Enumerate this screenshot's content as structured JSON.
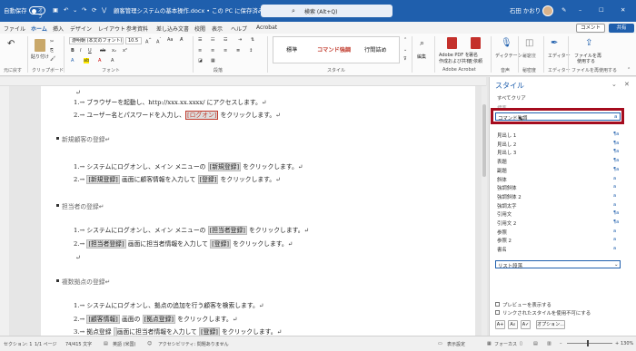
{
  "titlebar": {
    "autosave_label": "自動保存",
    "autosave_state": "オフ",
    "doc_title": "顧客管理システムの基本操作.docx • この PC に保存済み ⌄",
    "search_placeholder": "検索 (Alt+Q)",
    "user_name": "石田 かおり",
    "comment_label": "コメント",
    "share_label": "共有"
  },
  "tabs": [
    "ファイル",
    "ホーム",
    "挿入",
    "デザイン",
    "レイアウト",
    "参考資料",
    "差し込み文書",
    "校閲",
    "表示",
    "ヘルプ",
    "Acrobat"
  ],
  "ribbon": {
    "groups": {
      "undo": "元に戻す",
      "clipboard": "クリップボード",
      "font": "フォント",
      "paragraph": "段落",
      "styles": "スタイル",
      "acrobat": "Adobe Acrobat",
      "voice": "音声",
      "sensitivity": "秘密度",
      "editor": "エディター",
      "share": "ファイルを再使用する"
    },
    "paste": "貼り付け",
    "font_name": "游明朝 (本文のフォント)",
    "font_size": "10.5",
    "style_gallery": [
      "標準",
      "コマンド強調",
      "行間詰め"
    ],
    "editing": "編集",
    "pdf_line1": "Adobe PDF を",
    "pdf_line2": "作成および共有",
    "sign_line1": "署名",
    "sign_line2": "を依頼",
    "dictate": "ディクテーション",
    "sensitivity": "秘密度",
    "editor": "エディター",
    "share_file": "ファイルを再",
    "share_file_line2": "使用する"
  },
  "doc": {
    "para_mark": "↵",
    "s1": {
      "items": {
        "0": "1.→ ブラウザーを起動し、http://xxx.xx.xxxx/ にアクセスします。↵",
        "1a": "2.→ ユーザー名とパスワードを入力し、",
        "1b": "[ログオン]",
        "1c": " をクリックします。↵"
      }
    },
    "s2": {
      "heading": "新規顧客の登録↵",
      "items": {
        "0a": "1.→ システムにログオンし、メイン メニューの ",
        "0b": "[新規登録]",
        "0c": " をクリックします。↵",
        "1a": "2.→ ",
        "1b": "[新規登録]",
        "1c": " 画面に顧客情報を入力して ",
        "1d": "[登録]",
        "1e": " をクリックします。↵"
      }
    },
    "s3": {
      "heading": "担当者の登録↵",
      "items": {
        "0a": "1.→ システムにログオンし、メイン メニューの ",
        "0b": "[担当者登録]",
        "0c": " をクリックします。↵",
        "1a": "2.→ ",
        "1b": "[担当者登録]",
        "1c": " 画面に担当者情報を入力して ",
        "1d": "[登録]",
        "1e": " をクリックします。↵"
      }
    },
    "s4": {
      "heading": "複数拠点の登録↵",
      "items": {
        "0": "1.→ システムにログオンし、拠点の追加を行う顧客を検索します。↵",
        "1a": "2.→ ",
        "1b": "[顧客情報]",
        "1c": " 画面の ",
        "1d": "[拠点登録]",
        "1e": " をクリックします。↵",
        "2a": "3.→ 拠点登録 ",
        "2b": "",
        "2c": "画面に担当者情報を入力して ",
        "2d": "[登録]",
        "2e": " をクリックします。↵"
      }
    }
  },
  "pane": {
    "title": "スタイル",
    "clear_all": "すべてクリア",
    "partial": "標準",
    "selected": "コマンド強調",
    "items": [
      {
        "label": "見出し 1",
        "sym": "¶a"
      },
      {
        "label": "見出し 2",
        "sym": "¶a"
      },
      {
        "label": "見出し 3",
        "sym": "¶a"
      },
      {
        "label": "表題",
        "sym": "¶a"
      },
      {
        "label": "副題",
        "sym": "¶a"
      },
      {
        "label": "斜体",
        "sym": "a"
      },
      {
        "label": "強調斜体",
        "sym": "a"
      },
      {
        "label": "強調斜体 2",
        "sym": "a"
      },
      {
        "label": "強調太字",
        "sym": "a"
      },
      {
        "label": "引用文",
        "sym": "¶a"
      },
      {
        "label": "引用文 2",
        "sym": "¶a"
      },
      {
        "label": "参照",
        "sym": "a"
      },
      {
        "label": "参照 2",
        "sym": "a"
      },
      {
        "label": "書名",
        "sym": "a"
      }
    ],
    "list_selected": "リスト段落",
    "preview": "プレビューを表示する",
    "linked": "リンクされたスタイルを使用不可にする",
    "options": "オプション..."
  },
  "status": {
    "section": "セクション: 1",
    "page": "1/1 ページ",
    "words": "74/415 文字",
    "language": "英語 (米国)",
    "accessibility": "アクセシビリティ: 問題ありません",
    "display_settings": "表示設定",
    "focus": "フォーカス",
    "zoom": "130%"
  }
}
